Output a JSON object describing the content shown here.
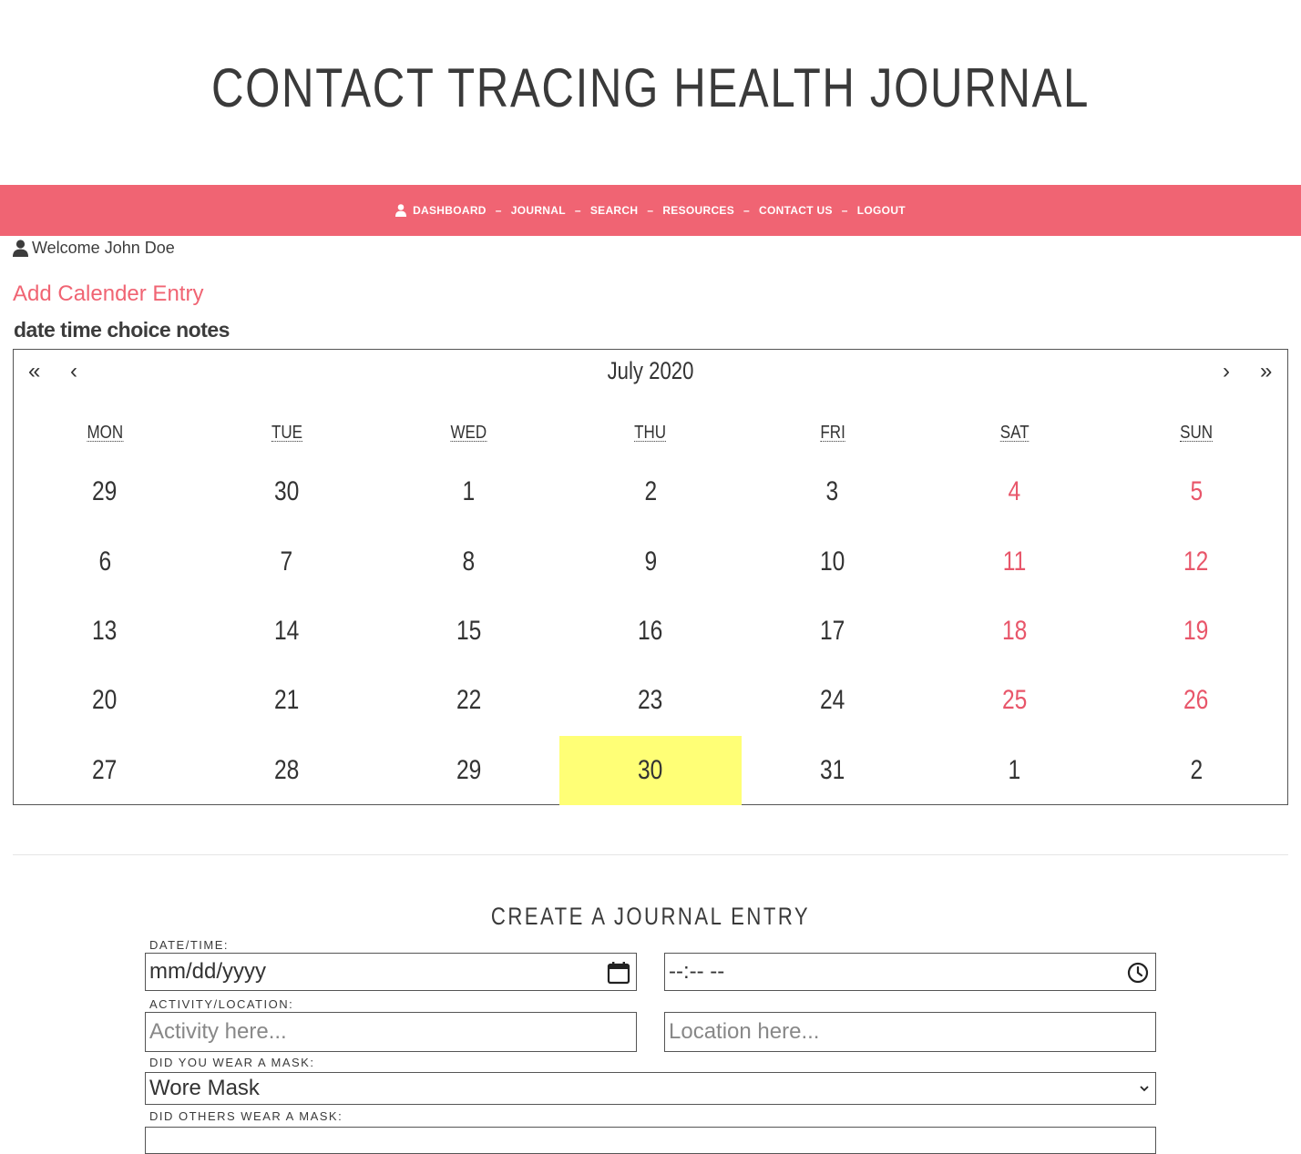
{
  "header": {
    "title": "CONTACT TRACING HEALTH JOURNAL"
  },
  "nav": {
    "items": [
      {
        "label": "DASHBOARD",
        "icon": "user-icon"
      },
      {
        "label": "JOURNAL"
      },
      {
        "label": "SEARCH"
      },
      {
        "label": "RESOURCES"
      },
      {
        "label": "CONTACT US"
      },
      {
        "label": "LOGOUT"
      }
    ],
    "separator": "–",
    "background_color": "#f06473"
  },
  "welcome": {
    "text": "Welcome John Doe",
    "icon": "user-icon"
  },
  "add_entry": {
    "label": "Add Calender Entry"
  },
  "field_labels": "date time choice notes",
  "calendar": {
    "nav": {
      "prev_year": "«",
      "prev_month": "‹",
      "next_month": "›",
      "next_year": "»"
    },
    "title": "July 2020",
    "weekdays": [
      "MON",
      "TUE",
      "WED",
      "THU",
      "FRI",
      "SAT",
      "SUN"
    ],
    "weeks": [
      [
        "29",
        "30",
        "1",
        "2",
        "3",
        "4",
        "5"
      ],
      [
        "6",
        "7",
        "8",
        "9",
        "10",
        "11",
        "12"
      ],
      [
        "13",
        "14",
        "15",
        "16",
        "17",
        "18",
        "19"
      ],
      [
        "20",
        "21",
        "22",
        "23",
        "24",
        "25",
        "26"
      ],
      [
        "27",
        "28",
        "29",
        "30",
        "31",
        "1",
        "2"
      ]
    ],
    "today": "30",
    "weekend_color": "#e8566a",
    "today_color": "#ffff76"
  },
  "journal_form": {
    "title": "CREATE A JOURNAL ENTRY",
    "datetime_label": "DATE/TIME:",
    "date_value": "mm/dd/yyyy",
    "time_value": "--:-- --",
    "activity_label": "ACTIVITY/LOCATION:",
    "activity_placeholder": "Activity here...",
    "location_placeholder": "Location here...",
    "mask_label": "DID YOU WEAR A MASK:",
    "mask_value": "Wore Mask",
    "others_mask_label": "DID OTHERS WEAR A MASK:"
  }
}
